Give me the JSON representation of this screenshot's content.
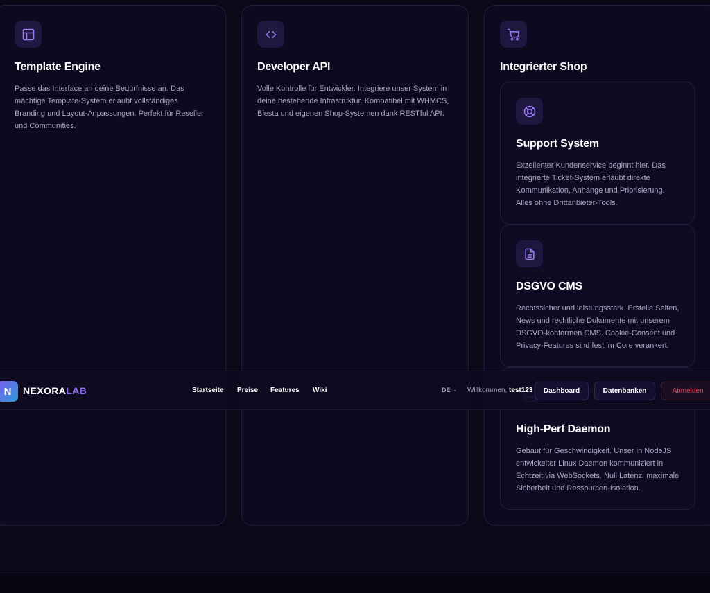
{
  "features": {
    "template_engine": {
      "title": "Template Engine",
      "desc_lines": [
        "Passe das Interface an deine Bedürfnisse an. Das",
        "mächtige Template-System erlaubt vollständiges",
        "Branding und Layout-Anpassungen. Perfekt für Reseller",
        "und Communities."
      ]
    },
    "developer_api": {
      "title": "Developer API",
      "desc_lines": [
        "Volle Kontrolle für Entwickler. Integriere unser System in",
        "deine bestehende Infrastruktur. Kompatibel mit WHMCS,",
        "Blesta und eigenen Shop-Systemen dank RESTful API."
      ]
    },
    "shop": {
      "title": "Integrierter Shop"
    },
    "support": {
      "title": "Support System",
      "desc_lines": [
        "Exzellenter Kundenservice beginnt hier. Das",
        "integrierte Ticket-System erlaubt direkte",
        "Kommunikation, Anhänge und Priorisierung.",
        "Alles ohne Drittanbieter-Tools."
      ]
    },
    "cms": {
      "title": "DSGVO CMS",
      "desc_lines": [
        "Rechtssicher und leistungsstark. Erstelle Seiten,",
        "News und rechtliche Dokumente mit unserem",
        "DSGVO-konformen CMS. Cookie-Consent und",
        "Privacy-Features sind fest im Core verankert."
      ]
    },
    "daemon": {
      "title": "High-Perf Daemon",
      "desc_lines": [
        "Gebaut für Geschwindigkeit. Unser in NodeJS",
        "entwickelter Linux Daemon kommuniziert in",
        "Echtzeit via WebSockets. Null Latenz, maximale",
        "Sicherheit und Ressourcen-Isolation."
      ]
    }
  },
  "nav": {
    "logo_mark": "N",
    "logo_part1": "NEXORA",
    "logo_part2": "LAB",
    "links": [
      "Startseite",
      "Preise",
      "Features",
      "Wiki"
    ],
    "lang": "DE",
    "welcome_prefix": "Willkommen, ",
    "username": "test123",
    "dashboard": "Dashboard",
    "databases": "Datenbanken",
    "logout": "Abmelden"
  },
  "colors": {
    "background": "#0b0818",
    "accent": "#8a6cf0",
    "danger": "#e0485c"
  },
  "icons": {
    "template_engine": "layout-icon",
    "developer_api": "code-icon",
    "shop": "cart-icon",
    "support": "lifebuoy-icon",
    "cms": "document-icon",
    "daemon": "server-icon"
  }
}
